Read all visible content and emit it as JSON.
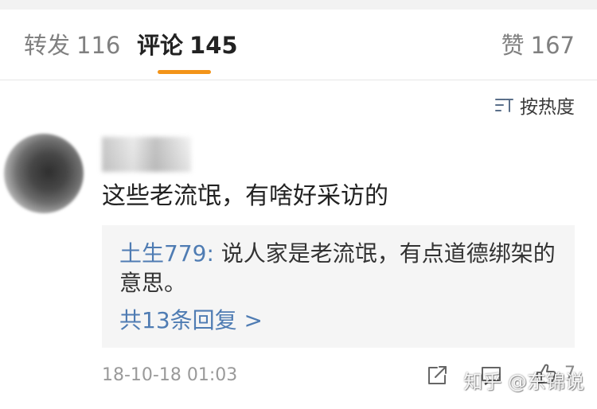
{
  "tabs": {
    "repost": {
      "label": "转发",
      "count": "116"
    },
    "comments": {
      "label": "评论",
      "count": "145"
    },
    "likes": {
      "label": "赞",
      "count": "167"
    }
  },
  "sort": {
    "label": "按热度",
    "icon": "sort-icon"
  },
  "comment": {
    "text": "这些老流氓，有啥好采访的",
    "reply": {
      "author": "土生779:",
      "text": "说人家是老流氓，有点道德绑架的意思。",
      "more": "共13条回复 >"
    },
    "timestamp": "18-10-18 01:03",
    "like_count": "7",
    "icons": {
      "share": "share-icon",
      "comment": "comment-icon",
      "like": "thumbs-up-icon"
    }
  },
  "watermark": "知乎 @东锦说",
  "colors": {
    "active_tab_indicator": "#f39419",
    "link": "#4f7cb3",
    "inactive_tab": "#808080",
    "active_tab": "#222222",
    "reply_background": "#f5f5f5",
    "timestamp": "#9a9a9a"
  }
}
